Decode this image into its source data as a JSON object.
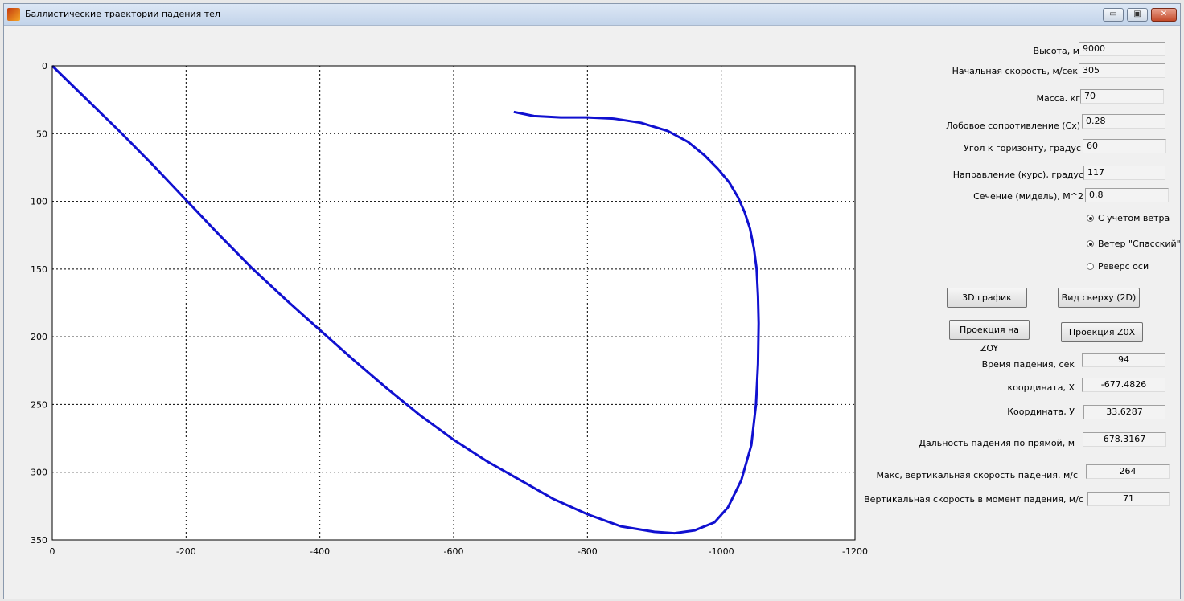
{
  "window": {
    "title": "Баллистические траектории падения тел",
    "minimize_glyph": "▭",
    "maximize_glyph": "▣",
    "close_glyph": "✕"
  },
  "inputs": {
    "height": {
      "label": "Высота, м",
      "value": "9000"
    },
    "initial_speed": {
      "label": "Начальная скорость, м/сек",
      "value": "305"
    },
    "mass": {
      "label": "Масса. кг",
      "value": "70"
    },
    "drag": {
      "label": "Лобовое сопротивление (Cx)",
      "value": "0.28"
    },
    "angle": {
      "label": "Угол к горизонту, градус",
      "value": "60"
    },
    "direction": {
      "label": "Направление  (курс), градус",
      "value": "117"
    },
    "section": {
      "label": "Сечение (мидель), М^2",
      "value": "0.8"
    }
  },
  "options": {
    "wind": {
      "label": "С учетом ветра",
      "checked": true
    },
    "wind_spassky": {
      "label": "Ветер \"Спасский\"",
      "checked": true
    },
    "axis_reverse": {
      "label": "Реверс оси",
      "checked": false
    }
  },
  "buttons": {
    "plot_3d": "3D график",
    "top_view": "Вид сверху (2D)",
    "projection_zoy": "Проекция на ZOY",
    "projection_zox": "Проекция Z0X"
  },
  "results": {
    "fall_time": {
      "label": "Время падения, сек",
      "value": "94"
    },
    "coord_x": {
      "label": "координата, X",
      "value": "-677.4826"
    },
    "coord_y": {
      "label": "Координата, У",
      "value": "33.6287"
    },
    "distance": {
      "label": "Дальность падения по прямой, м",
      "value": "678.3167"
    },
    "max_vspeed": {
      "label": "Макс,  вертикальная скорость падения. м/с",
      "value": "264"
    },
    "impact_vspeed": {
      "label": "Вертикальная  скорость в момент падения, м/с",
      "value": "71"
    }
  },
  "chart_data": {
    "type": "line",
    "title": "",
    "xlabel": "",
    "ylabel": "",
    "xlim": [
      0,
      -1200
    ],
    "ylim": [
      0,
      350
    ],
    "y_reversed": true,
    "x_ticks": [
      0,
      -200,
      -400,
      -600,
      -800,
      -1000,
      -1200
    ],
    "y_ticks": [
      0,
      50,
      100,
      150,
      200,
      250,
      300,
      350
    ],
    "grid": true,
    "grid_style": "dotted",
    "line_color": "#1010d0",
    "series": [
      {
        "x": [
          0,
          -50,
          -100,
          -150,
          -200,
          -250,
          -300,
          -350,
          -400,
          -450,
          -500,
          -550,
          -600,
          -650,
          -700,
          -750,
          -800,
          -850,
          -900,
          -930,
          -960,
          -990,
          -1010,
          -1030,
          -1045,
          -1052,
          -1055,
          -1056,
          -1055,
          -1053,
          -1049,
          -1043,
          -1035,
          -1025,
          -1012,
          -995,
          -975,
          -950,
          -920,
          -880,
          -840,
          -800,
          -760,
          -720,
          -690
        ],
        "y": [
          0,
          24,
          48,
          73,
          99,
          125,
          150,
          173,
          195,
          217,
          238,
          258,
          276,
          292,
          306,
          320,
          331,
          340,
          344,
          345,
          343,
          337,
          326,
          306,
          280,
          250,
          220,
          190,
          170,
          150,
          135,
          120,
          108,
          97,
          86,
          76,
          66,
          56,
          48,
          42,
          39,
          38,
          38,
          37,
          34
        ]
      }
    ]
  }
}
